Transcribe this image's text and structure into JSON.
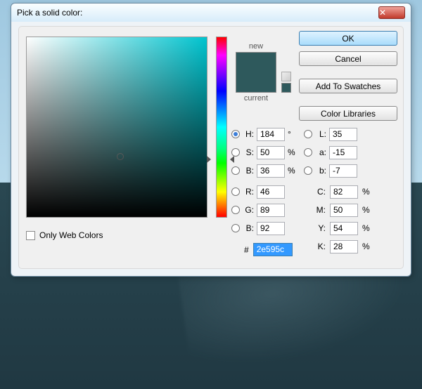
{
  "window": {
    "title": "Pick a solid color:"
  },
  "buttons": {
    "ok": "OK",
    "cancel": "Cancel",
    "addswatches": "Add To Swatches",
    "libraries": "Color Libraries"
  },
  "swatch": {
    "new_label": "new",
    "current_label": "current",
    "new_color": "#2e595c",
    "current_color": "#2e595c"
  },
  "hsb": {
    "H_label": "H:",
    "H": "184",
    "H_unit": "°",
    "S_label": "S:",
    "S": "50",
    "S_unit": "%",
    "B_label": "B:",
    "B": "36",
    "B_unit": "%"
  },
  "rgb": {
    "R_label": "R:",
    "R": "46",
    "G_label": "G:",
    "G": "89",
    "B_label": "B:",
    "B": "92"
  },
  "lab": {
    "L_label": "L:",
    "L": "35",
    "a_label": "a:",
    "a": "-15",
    "b_label": "b:",
    "b": "-7"
  },
  "cmyk": {
    "C_label": "C:",
    "C": "82",
    "M_label": "M:",
    "M": "50",
    "Y_label": "Y:",
    "Y": "54",
    "K_label": "K:",
    "K": "28",
    "unit": "%"
  },
  "hex": {
    "label": "#",
    "value": "2e595c"
  },
  "owc": {
    "label": "Only Web Colors"
  }
}
